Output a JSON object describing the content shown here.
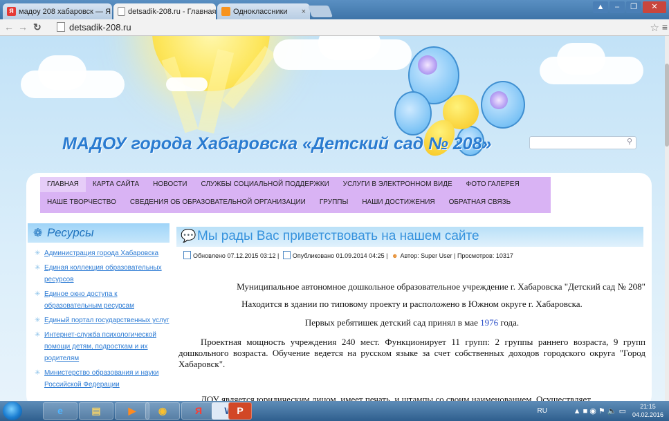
{
  "browser": {
    "tabs": [
      {
        "label": "мадоу 208 хабаровск — Я",
        "favicon": "Я",
        "favicon_color": "#e53935"
      },
      {
        "label": "detsadik-208.ru - Главная",
        "favicon": "",
        "favicon_color": "#ffffff"
      },
      {
        "label": "Одноклассники",
        "favicon": "ок",
        "favicon_color": "#f7931e"
      }
    ],
    "close_glyph": "×",
    "url": "detsadik-208.ru"
  },
  "site": {
    "title": "МАДОУ города Хабаровска «Детский сад № 208»",
    "search_placeholder": ""
  },
  "nav": {
    "row1": [
      "ГЛАВНАЯ",
      "КАРТА САЙТА",
      "НОВОСТИ",
      "СЛУЖБЫ СОЦИАЛЬНОЙ ПОДДЕРЖКИ",
      "УСЛУГИ В ЭЛЕКТРОННОМ ВИДЕ",
      "ФОТО ГАЛЕРЕЯ"
    ],
    "row2": [
      "НАШЕ ТВОРЧЕСТВО",
      "СВЕДЕНИЯ ОБ ОБРАЗОВАТЕЛЬНОЙ ОРГАНИЗАЦИИ",
      "ГРУППЫ",
      "НАШИ ДОСТИЖЕНИЯ",
      "ОБРАТНАЯ СВЯЗЬ"
    ]
  },
  "sidebar": {
    "heading": "Ресурсы",
    "items": [
      "Администрация города Хабаровска",
      "Единая коллекция образовательных ресурсов",
      "Единое окно доступа к образовательным ресурсам",
      "Единый портал государственных услуг",
      "Интернет-служба психологической помощи детям, подросткам и их родителям",
      "Министерство образования и науки Российской Федерации"
    ]
  },
  "article": {
    "title": "Мы рады Вас приветствовать на нашем сайте",
    "updated": "Обновлено 07.12.2015 03:12",
    "published": "Опубликовано 01.09.2014 04:25",
    "author": "Автор: Super User",
    "views": "Просмотров: 10317",
    "p1": "Муниципальное автономное дошкольное образовательное учреждение г. Хабаровска \"Детский сад № 208\"",
    "p2": "Находится в здании по типовому проекту и расположено в Южном округе г. Хабаровска.",
    "p3_before": "Первых ребятишек детский сад принял в мае ",
    "p3_year": "1976",
    "p3_after": " года.",
    "p4": "Проектная мощность учреждения 240 мест. Функционирует 11 групп: 2 группы раннего возраста, 9 групп дошкольного возраста. Обучение ведется на русском языке за счет собственных доходов городского округа \"Город Хабаровск\".",
    "p5": "ДОУ является юридическим лицом, имеет печать, и штампы со своим наименованием. Осуществляет"
  },
  "taskbar": {
    "apps": [
      "ie-icon",
      "explorer-icon",
      "media-player-icon",
      "chrome-icon",
      "yandex-icon",
      "word-icon",
      "powerpoint-icon"
    ],
    "lang": "RU",
    "time": "21:15",
    "date": "04.02.2016"
  }
}
